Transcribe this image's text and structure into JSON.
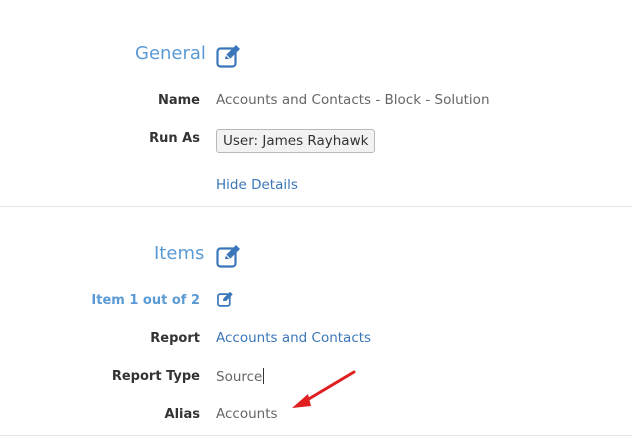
{
  "general": {
    "title": "General",
    "name_label": "Name",
    "name_value": "Accounts and Contacts - Block - Solution",
    "run_as_label": "Run As",
    "run_as_value": "User: James Rayhawk",
    "hide_details": "Hide Details"
  },
  "items": {
    "title": "Items",
    "item_counter": "Item 1 out of 2",
    "report_label": "Report",
    "report_value": "Accounts and Contacts",
    "report_type_label": "Report Type",
    "report_type_value": "Source",
    "alias_label": "Alias",
    "alias_value": "Accounts"
  },
  "icons": {
    "edit": "edit-pencil-square-icon",
    "arrow": "red-arrow-annotation"
  },
  "colors": {
    "section_title": "#5b9bd5",
    "link": "#3a76b8",
    "arrow": "#e02020"
  }
}
